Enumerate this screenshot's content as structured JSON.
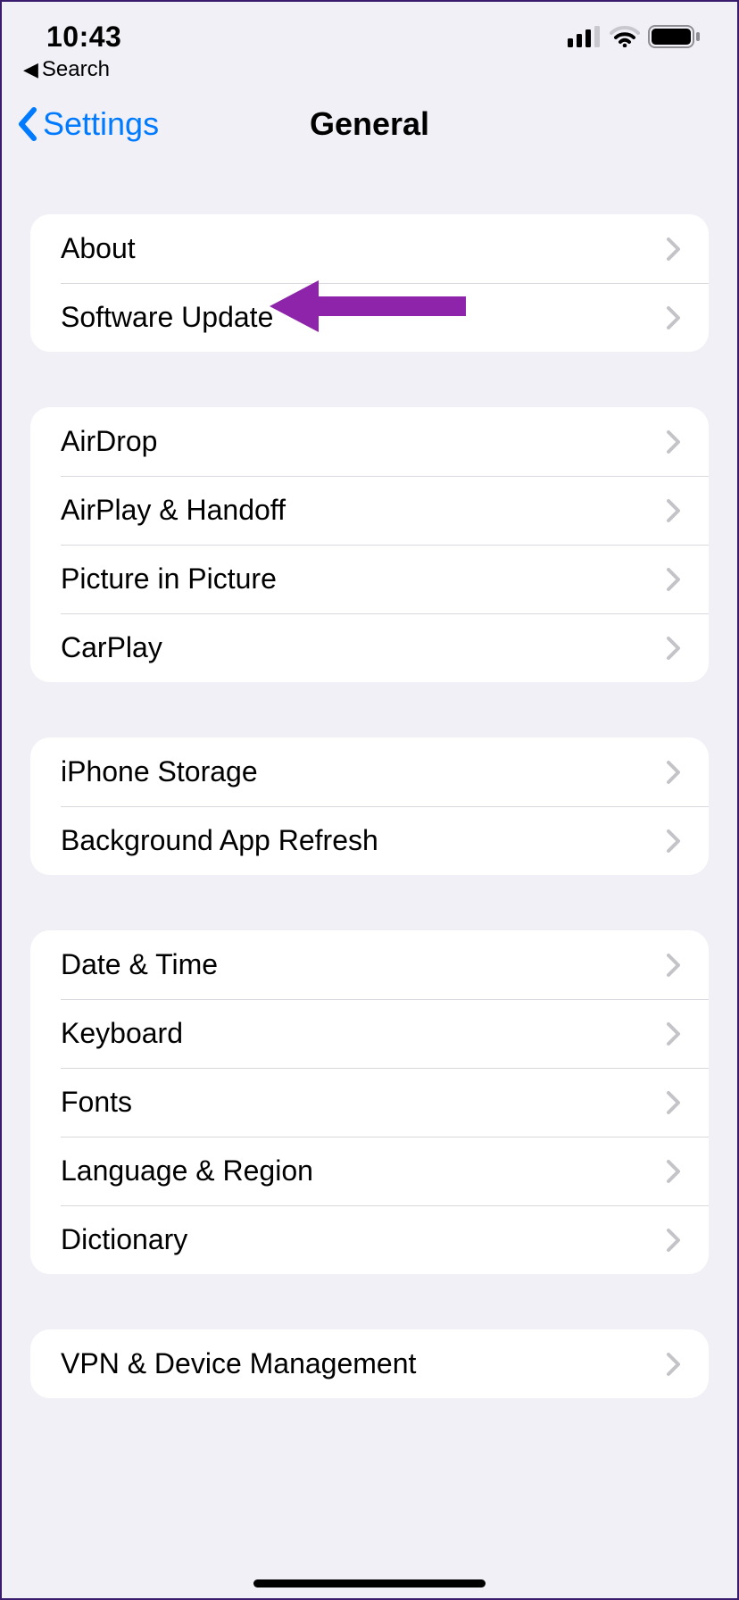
{
  "status": {
    "time": "10:43"
  },
  "breadcrumb": {
    "label": "Search"
  },
  "nav": {
    "back": "Settings",
    "title": "General"
  },
  "groups": [
    {
      "rows": [
        {
          "id": "about",
          "label": "About"
        },
        {
          "id": "software-update",
          "label": "Software Update"
        }
      ]
    },
    {
      "rows": [
        {
          "id": "airdrop",
          "label": "AirDrop"
        },
        {
          "id": "airplay-handoff",
          "label": "AirPlay & Handoff"
        },
        {
          "id": "picture-in-picture",
          "label": "Picture in Picture"
        },
        {
          "id": "carplay",
          "label": "CarPlay"
        }
      ]
    },
    {
      "rows": [
        {
          "id": "iphone-storage",
          "label": "iPhone Storage"
        },
        {
          "id": "background-app-refresh",
          "label": "Background App Refresh"
        }
      ]
    },
    {
      "rows": [
        {
          "id": "date-time",
          "label": "Date & Time"
        },
        {
          "id": "keyboard",
          "label": "Keyboard"
        },
        {
          "id": "fonts",
          "label": "Fonts"
        },
        {
          "id": "language-region",
          "label": "Language & Region"
        },
        {
          "id": "dictionary",
          "label": "Dictionary"
        }
      ]
    },
    {
      "rows": [
        {
          "id": "vpn-device-management",
          "label": "VPN & Device Management"
        }
      ]
    }
  ],
  "annotation": {
    "color": "#8e24aa",
    "points_to": "software-update"
  }
}
